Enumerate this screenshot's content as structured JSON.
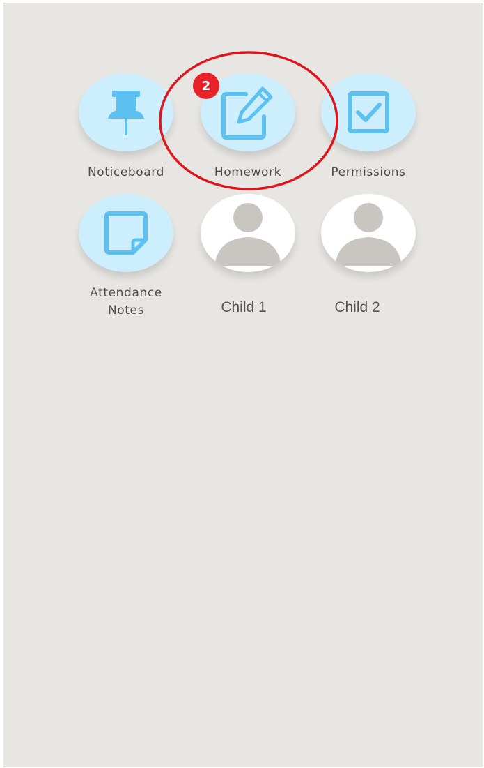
{
  "tiles": {
    "noticeboard": {
      "label": "Noticeboard",
      "icon": "pushpin-icon"
    },
    "homework": {
      "label": "Homework",
      "icon": "edit-icon",
      "badge": "2"
    },
    "permissions": {
      "label": "Permissions",
      "icon": "checkbox-icon"
    },
    "attendance": {
      "label_line1": "Attendance",
      "label_line2": "Notes",
      "icon": "note-icon"
    },
    "child1": {
      "label": "Child 1",
      "icon": "person-icon"
    },
    "child2": {
      "label": "Child 2",
      "icon": "person-icon"
    }
  },
  "colors": {
    "tile_bg": "#cdeefd",
    "icon": "#5cc1f0",
    "background": "#e8e6e3",
    "badge": "#e82229",
    "annotation_ring": "#e0151c",
    "avatar": "#c9c6c2"
  }
}
